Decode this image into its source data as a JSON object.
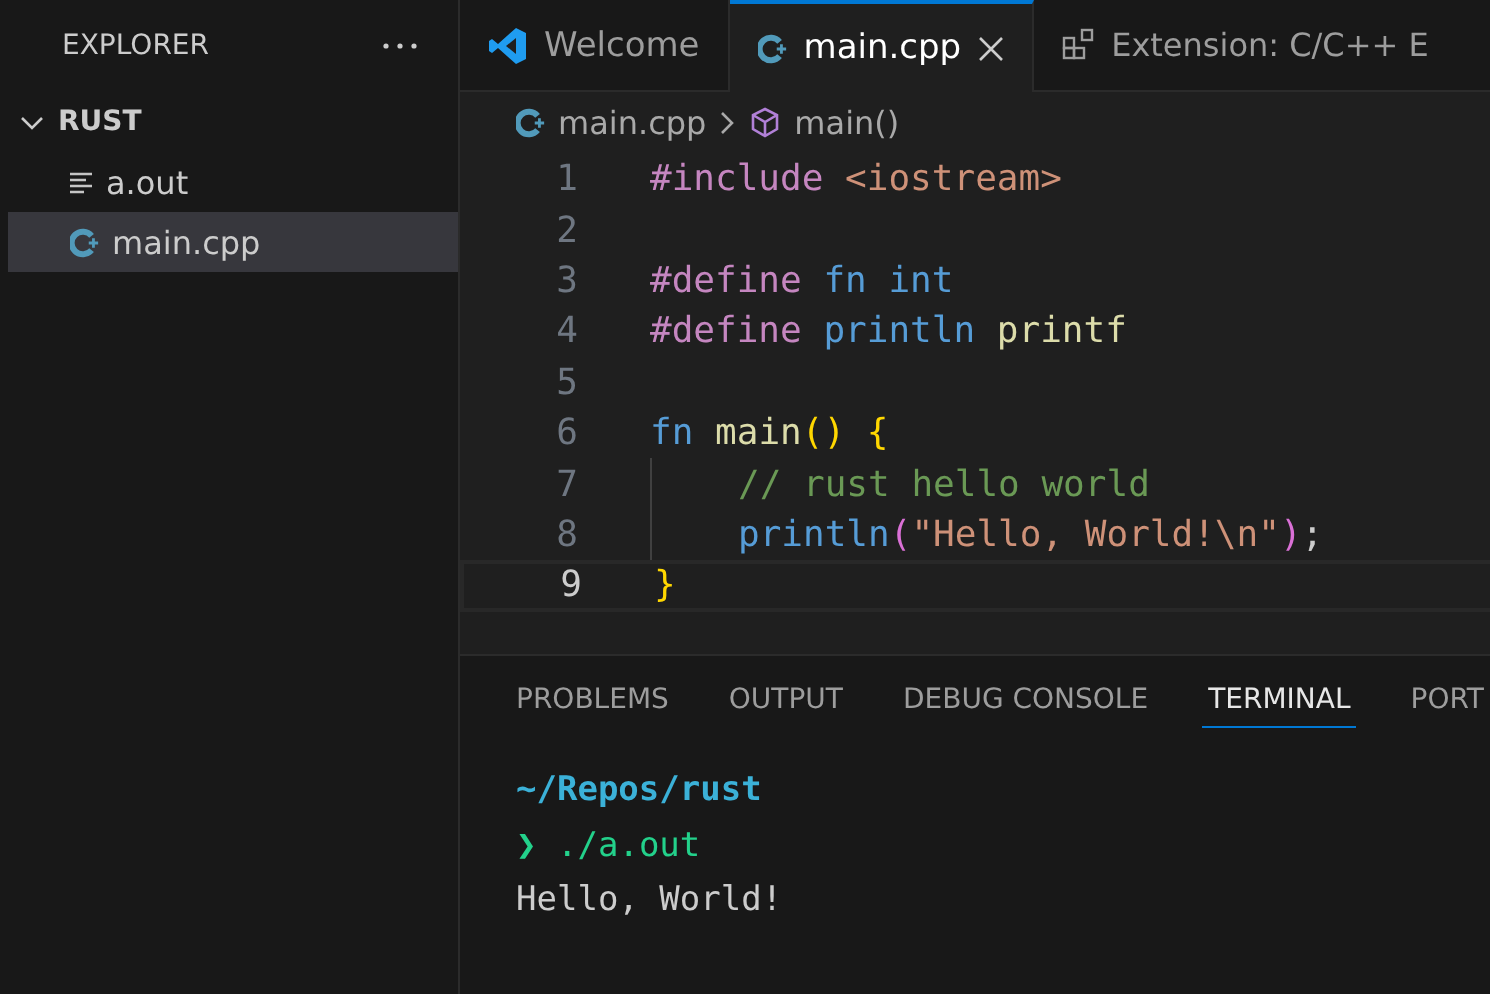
{
  "sidebar": {
    "title": "EXPLORER",
    "folder": {
      "name": "RUST",
      "expanded": true,
      "children": [
        {
          "name": "a.out",
          "kind": "binary",
          "selected": false
        },
        {
          "name": "main.cpp",
          "kind": "cpp",
          "selected": true
        }
      ]
    }
  },
  "tabs": [
    {
      "label": "Welcome",
      "kind": "welcome",
      "selected": false
    },
    {
      "label": "main.cpp",
      "kind": "cpp",
      "selected": true
    },
    {
      "label": "Extension: C/C++ E",
      "kind": "extension",
      "selected": false
    }
  ],
  "breadcrumb": [
    {
      "label": "main.cpp",
      "kind": "cpp"
    },
    {
      "label": "main()",
      "kind": "symbol"
    }
  ],
  "code": [
    {
      "number": "1",
      "current": false,
      "indented": false,
      "tokens": [
        {
          "kind": "directive",
          "text": "#include "
        },
        {
          "kind": "include_path",
          "text": "<iostream>"
        }
      ]
    },
    {
      "number": "2",
      "current": false,
      "indented": false
    },
    {
      "number": "3",
      "current": false,
      "indented": false,
      "tokens": [
        {
          "kind": "directive",
          "text": "#define "
        },
        {
          "kind": "macro",
          "text": "fn "
        },
        {
          "kind": "keyword",
          "text": "int"
        }
      ]
    },
    {
      "number": "4",
      "current": false,
      "indented": false,
      "tokens": [
        {
          "kind": "directive",
          "text": "#define "
        },
        {
          "kind": "macro",
          "text": "println "
        },
        {
          "kind": "function",
          "text": "printf"
        }
      ]
    },
    {
      "number": "5",
      "current": false,
      "indented": false
    },
    {
      "number": "6",
      "current": false,
      "indented": false,
      "tokens": [
        {
          "kind": "macro",
          "text": "fn "
        },
        {
          "kind": "function",
          "text": "main"
        },
        {
          "kind": "bracket1",
          "text": "() {"
        }
      ]
    },
    {
      "number": "7",
      "current": false,
      "indented": true,
      "tokens": [
        {
          "kind": "comment",
          "text": "// rust hello world"
        }
      ]
    },
    {
      "number": "8",
      "current": false,
      "indented": true,
      "tokens": [
        {
          "kind": "macro",
          "text": "println"
        },
        {
          "kind": "bracket2",
          "text": "("
        },
        {
          "kind": "string",
          "text": "\"Hello, World!\\n\""
        },
        {
          "kind": "bracket2",
          "text": ")"
        },
        {
          "kind": "punct",
          "text": ";"
        }
      ]
    },
    {
      "number": "9",
      "current": true,
      "indented": false,
      "tokens": [
        {
          "kind": "bracket1",
          "text": "}"
        }
      ]
    }
  ],
  "panel": {
    "tabs": [
      {
        "label": "PROBLEMS",
        "selected": false
      },
      {
        "label": "OUTPUT",
        "selected": false
      },
      {
        "label": "DEBUG CONSOLE",
        "selected": false
      },
      {
        "label": "TERMINAL",
        "selected": true
      },
      {
        "label": "PORT",
        "selected": false
      }
    ],
    "terminal": {
      "cwd": "~/Repos/rust",
      "prompt_symbol": "❯",
      "command": "./a.out",
      "output": "Hello, World!"
    }
  }
}
